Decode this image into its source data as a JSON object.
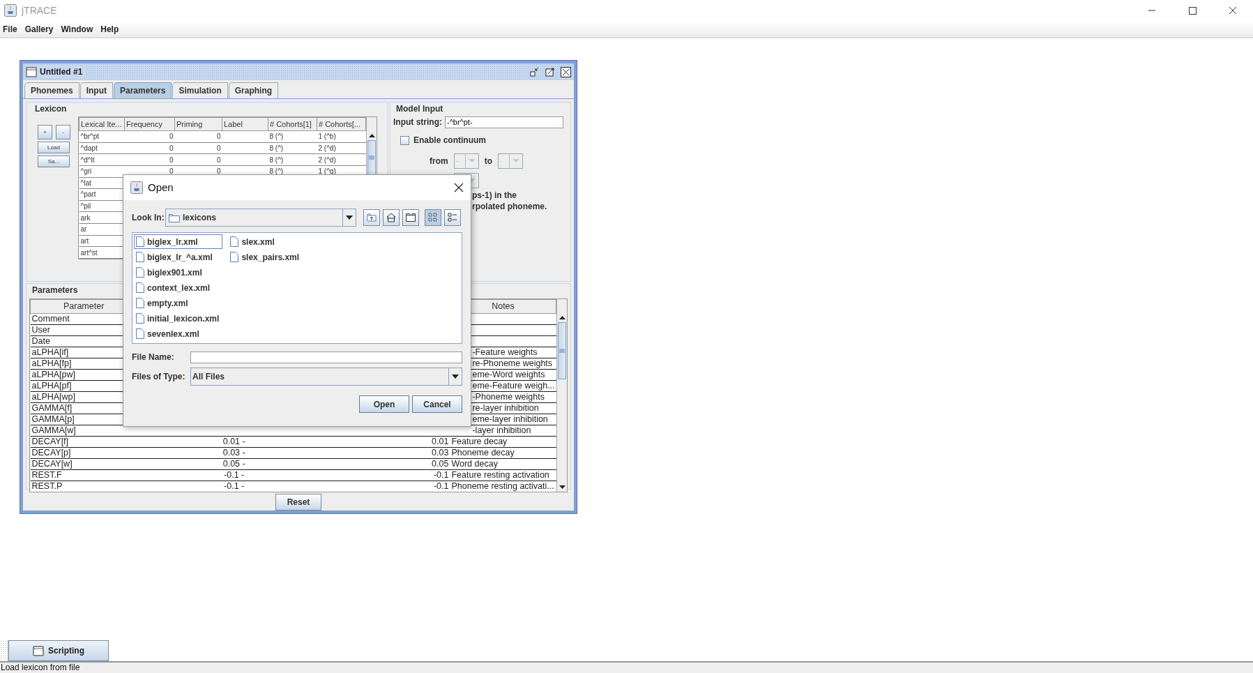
{
  "window": {
    "title": "jTRACE"
  },
  "menu": [
    "File",
    "Gallery",
    "Window",
    "Help"
  ],
  "frame": {
    "title": "Untitled #1"
  },
  "tabs": [
    {
      "label": "Phonemes",
      "selected": false
    },
    {
      "label": "Input",
      "selected": false
    },
    {
      "label": "Parameters",
      "selected": true
    },
    {
      "label": "Simulation",
      "selected": false
    },
    {
      "label": "Graphing",
      "selected": false
    }
  ],
  "lexicon": {
    "title": "Lexicon",
    "buttons": [
      "+",
      "-",
      "Load",
      "Sa..."
    ],
    "columns": [
      "Lexical Ite...",
      "Frequency",
      "Priming",
      "Label",
      "# Cohorts[1]",
      "# Cohorts[..."
    ],
    "rows": [
      {
        "item": "^br^pt",
        "frequency": "0",
        "priming": "0",
        "cohorts_1": "8 (^)",
        "cohorts_2": "1 (^b)"
      },
      {
        "item": "^dapt",
        "frequency": "0",
        "priming": "0",
        "cohorts_1": "8 (^)",
        "cohorts_2": "2 (^d)"
      },
      {
        "item": "^d^lt",
        "frequency": "0",
        "priming": "0",
        "cohorts_1": "8 (^)",
        "cohorts_2": "2 (^d)"
      },
      {
        "item": "^gri",
        "frequency": "0",
        "priming": "0",
        "cohorts_1": "8 (^)",
        "cohorts_2": "1 (^g)"
      },
      {
        "item": "^lat"
      },
      {
        "item": "^part"
      },
      {
        "item": "^pil"
      },
      {
        "item": "ark"
      },
      {
        "item": "ar"
      },
      {
        "item": "art"
      },
      {
        "item": "art^st"
      }
    ]
  },
  "model_input": {
    "title": "Model Input",
    "input_label": "Input string:",
    "input_value": "-^br^pt-",
    "continuum": {
      "label": "Enable continuum",
      "checked": false
    },
    "from_label": "from",
    "to_label": "to",
    "from_combo": {
      "value": "-",
      "disabled": true
    },
    "to_combo": {
      "value": "-",
      "disabled": true
    },
    "note_fragments": [
      "ps-1) in the",
      "rpolated phoneme."
    ]
  },
  "parameters": {
    "title": "Parameters",
    "parameter_header": "Parameter",
    "notes_header": "Notes",
    "rows": [
      {
        "parameter": "Comment"
      },
      {
        "parameter": "User"
      },
      {
        "parameter": "Date"
      },
      {
        "parameter": "aLPHA[if]",
        "notes_fragment": "-Feature weights"
      },
      {
        "parameter": "aLPHA[fp]",
        "notes_fragment": "re-Phoneme weights"
      },
      {
        "parameter": "aLPHA[pw]",
        "notes_fragment": "eme-Word weights"
      },
      {
        "parameter": "aLPHA[pf]",
        "notes_fragment": "eme-Feature  weigh..."
      },
      {
        "parameter": "aLPHA[wp]",
        "notes_fragment": "-Phoneme weights"
      },
      {
        "parameter": "GAMMA[f]",
        "notes_fragment": "re-layer inhibition"
      },
      {
        "parameter": "GAMMA[p]",
        "notes_fragment": "eme-layer inhibition"
      },
      {
        "parameter": "GAMMA[w]",
        "notes_fragment": "-layer inhibition"
      },
      {
        "parameter": "DECAY[f]",
        "value": "0.01 -",
        "default": "0.01",
        "notes": "Feature decay"
      },
      {
        "parameter": "DECAY[p]",
        "value": "0.03 -",
        "default": "0.03",
        "notes": "Phoneme decay"
      },
      {
        "parameter": "DECAY[w]",
        "value": "0.05 -",
        "default": "0.05",
        "notes": "Word decay"
      },
      {
        "parameter": "REST.F",
        "value": "-0.1 -",
        "default": "-0.1",
        "notes": "Feature resting activation"
      },
      {
        "parameter": "REST.P",
        "value": "-0.1 -",
        "default": "-0.1",
        "notes": "Phoneme resting activati..."
      }
    ]
  },
  "reset_button": "Reset",
  "dialog": {
    "title": "Open",
    "look_in_label": "Look In:",
    "look_in_value": "lexicons",
    "toolbar": [
      {
        "kind": "up",
        "selected": false
      },
      {
        "kind": "home",
        "selected": false
      },
      {
        "kind": "new-folder",
        "selected": false
      },
      {
        "kind": "list",
        "selected": true
      },
      {
        "kind": "details",
        "selected": false
      }
    ],
    "files": [
      {
        "name": "biglex_lr.xml",
        "selected": true
      },
      {
        "name": "biglex_lr_^a.xml",
        "selected": false
      },
      {
        "name": "biglex901.xml",
        "selected": false
      },
      {
        "name": "context_lex.xml",
        "selected": false
      },
      {
        "name": "empty.xml",
        "selected": false
      },
      {
        "name": "initial_lexicon.xml",
        "selected": false
      },
      {
        "name": "sevenlex.xml",
        "selected": false
      },
      {
        "name": "slex.xml",
        "selected": false
      },
      {
        "name": "slex_pairs.xml",
        "selected": false
      }
    ],
    "file_name_label": "File Name:",
    "file_type_label": "Files of Type:",
    "file_type_value": "All Files",
    "buttons": [
      "Open",
      "Cancel"
    ]
  },
  "taskbar": [
    {
      "label": "Scripting"
    }
  ],
  "status_bar": "Load lexicon from file"
}
